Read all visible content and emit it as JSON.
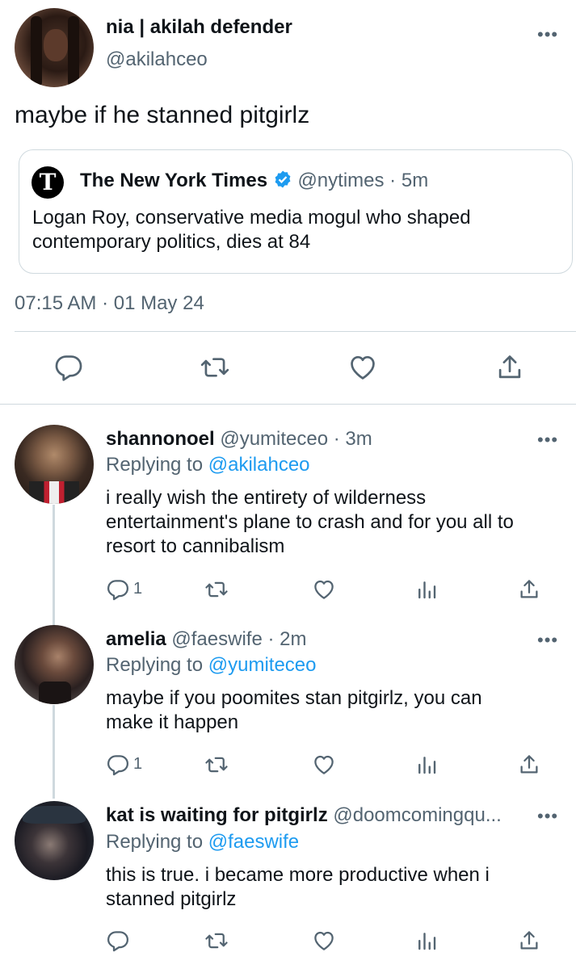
{
  "main_tweet": {
    "display_name": "nia | akilah defender",
    "handle": "@akilahceo",
    "text": "maybe if he stanned pitgirlz",
    "quoted": {
      "name": "The New York Times",
      "handle": "@nytimes",
      "sep": "·",
      "time": "5m",
      "text_line1": "Logan Roy, conservative media mogul who shaped",
      "text_line2": "contemporary politics, dies at 84"
    },
    "timestamp": "07:15 AM · 01 May 24"
  },
  "replies": [
    {
      "name": "shannonoel",
      "handle": "@yumiteceo",
      "time": "· 3m",
      "replying_prefix": "Replying to",
      "replying_to": "@akilahceo",
      "lines": [
        "i really wish the entirety of wilderness",
        "entertainment's plane to crash and for you all to",
        "resort to cannibalism"
      ],
      "reply_count": "1"
    },
    {
      "name": "amelia",
      "handle": "@faeswife",
      "time": "· 2m",
      "replying_prefix": "Replying to",
      "replying_to": "@yumiteceo",
      "lines": [
        "maybe if you poomites stan pitgirlz, you can",
        "make it happen"
      ],
      "reply_count": "1"
    },
    {
      "name": "kat is waiting for pitgirlz",
      "handle": "@doomcomingqu...",
      "time": "",
      "replying_prefix": "Replying to",
      "replying_to": "@faeswife",
      "lines": [
        "this is true. i became more productive when i",
        "stanned pitgirlz"
      ],
      "reply_count": ""
    }
  ],
  "colors": {
    "link": "#1d9bf0",
    "secondary": "#536471",
    "divider": "#cfd9de",
    "verified": "#1d9bf0"
  },
  "icons": [
    "reply-icon",
    "retweet-icon",
    "like-icon",
    "share-icon",
    "analytics-icon",
    "more-icon",
    "verified-badge-icon",
    "nyt-logo-icon"
  ]
}
